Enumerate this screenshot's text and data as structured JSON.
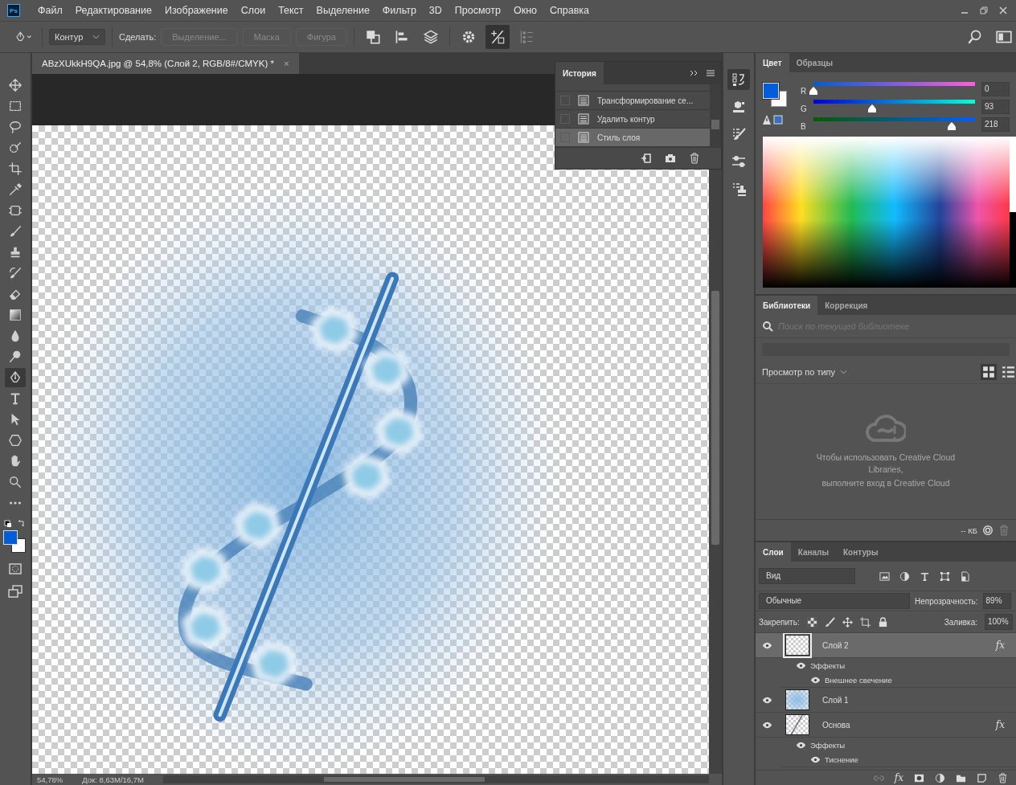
{
  "app": {
    "logo": "Ps"
  },
  "menu": [
    "Файл",
    "Редактирование",
    "Изображение",
    "Слои",
    "Текст",
    "Выделение",
    "Фильтр",
    "3D",
    "Просмотр",
    "Окно",
    "Справка"
  ],
  "options": {
    "preset": "Контур",
    "make_label": "Сделать:",
    "make_buttons": [
      {
        "label": "Выделение...",
        "disabled": true
      },
      {
        "label": "Маска",
        "disabled": true
      },
      {
        "label": "Фигура",
        "disabled": true
      }
    ]
  },
  "document_tab": {
    "title": "ABzXUkkH9QA.jpg @ 54,8% (Слой 2, RGB/8#/CMYK) *",
    "close": "×"
  },
  "tools": [
    {
      "kind": "move",
      "selected": false
    },
    {
      "kind": "marquee",
      "selected": false
    },
    {
      "kind": "lasso",
      "selected": false
    },
    {
      "kind": "quick",
      "selected": false
    },
    {
      "kind": "crop",
      "selected": false
    },
    {
      "kind": "eyedropper",
      "selected": false
    },
    {
      "kind": "healing",
      "selected": false
    },
    {
      "kind": "brush",
      "selected": false
    },
    {
      "kind": "stamp",
      "selected": false
    },
    {
      "kind": "historybrush",
      "selected": false
    },
    {
      "kind": "eraser",
      "selected": false
    },
    {
      "kind": "gradient",
      "selected": false
    },
    {
      "kind": "blur",
      "selected": false
    },
    {
      "kind": "dodge",
      "selected": false
    },
    {
      "kind": "pen",
      "selected": true
    },
    {
      "kind": "type",
      "selected": false
    },
    {
      "kind": "pathselect",
      "selected": false
    },
    {
      "kind": "shape",
      "selected": false
    },
    {
      "kind": "hand",
      "selected": false
    },
    {
      "kind": "zoom",
      "selected": false
    },
    {
      "kind": "more",
      "selected": false
    }
  ],
  "history": {
    "title": "История",
    "items": [
      {
        "label": "Трансформирование се...",
        "selected": false
      },
      {
        "label": "Удалить контур",
        "selected": false
      },
      {
        "label": "Стиль слоя",
        "selected": true
      }
    ]
  },
  "color": {
    "tabs": [
      {
        "label": "Цвет",
        "selected": true
      },
      {
        "label": "Образцы",
        "selected": false
      }
    ],
    "channels": [
      {
        "name": "R",
        "value": "0",
        "level": 0
      },
      {
        "name": "G",
        "value": "93",
        "level": 0.365
      },
      {
        "name": "B",
        "value": "218",
        "level": 0.855
      }
    ]
  },
  "libraries": {
    "tabs": [
      {
        "label": "Библиотеки",
        "selected": true
      },
      {
        "label": "Коррекция",
        "selected": false
      }
    ],
    "search": {
      "placeholder": "Поиск по текущей библиотеке"
    },
    "view_label": "Просмотр по типу",
    "message": [
      "Чтобы использовать Creative Cloud Libraries,",
      "выполните вход в Creative Cloud"
    ],
    "size": "-- КБ"
  },
  "layers": {
    "tabs": [
      {
        "label": "Слои",
        "selected": true
      },
      {
        "label": "Каналы",
        "selected": false
      },
      {
        "label": "Контуры",
        "selected": false
      }
    ],
    "filter": "Вид",
    "blend_mode": "Обычные",
    "opacity_label": "Непрозрачность:",
    "opacity": "89%",
    "lock_label": "Закрепить:",
    "fill_label": "Заливка:",
    "fill": "100%",
    "footer_fx": "fx",
    "items": [
      {
        "name": "Слой 2",
        "visible": true,
        "selected": true,
        "badge": "fx",
        "children": [
          {
            "name": "Эффекты",
            "visible": true,
            "children": [
              {
                "name": "Внешнее свечение",
                "visible": true
              }
            ]
          }
        ]
      },
      {
        "name": "Слой 1",
        "visible": true,
        "selected": false
      },
      {
        "name": "Основа",
        "visible": true,
        "selected": false,
        "badge": "fx",
        "children": [
          {
            "name": "Эффекты",
            "visible": true,
            "children": [
              {
                "name": "Тиснение",
                "visible": true
              }
            ]
          }
        ]
      }
    ]
  },
  "status": {
    "zoom": "54,78%",
    "doc": "Док: 8,63M/16,7M"
  }
}
